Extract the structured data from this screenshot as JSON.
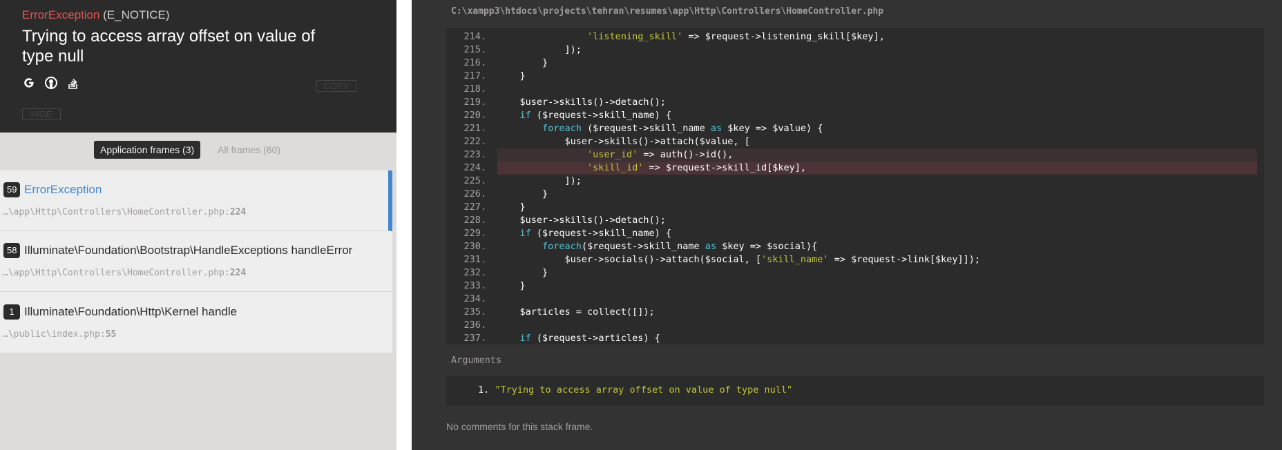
{
  "error": {
    "class": "ErrorException",
    "level": "(E_NOTICE)",
    "message": "Trying to access array offset on value of type null",
    "copy_label": "COPY",
    "hide_label": "HIDE",
    "search_icons": [
      "google-icon",
      "duckduckgo-icon",
      "stackoverflow-icon"
    ]
  },
  "filters": {
    "application": "Application frames (3)",
    "all": "All frames (60)"
  },
  "frames": [
    {
      "num": "59",
      "title": "ErrorException",
      "file": "…\\app\\Http\\Controllers\\HomeController.php",
      "line": "224"
    },
    {
      "num": "58",
      "title": "Illuminate\\Foundation\\Bootstrap\\HandleExceptions handleError",
      "file": "…\\app\\Http\\Controllers\\HomeController.php",
      "line": "224"
    },
    {
      "num": "1",
      "title": "Illuminate\\Foundation\\Http\\Kernel handle",
      "file": "…\\public\\index.php",
      "line": "55"
    }
  ],
  "code": {
    "path": "C:\\xampp3\\htdocs\\projects\\tehran\\resumes\\app\\Http\\Controllers\\HomeController.php",
    "lines": [
      {
        "n": "214.",
        "text": "                'listening_skill' => $request->listening_skill[$key],"
      },
      {
        "n": "215.",
        "text": "            ]);"
      },
      {
        "n": "216.",
        "text": "        }"
      },
      {
        "n": "217.",
        "text": "    }"
      },
      {
        "n": "218.",
        "text": ""
      },
      {
        "n": "219.",
        "text": "    $user->skills()->detach();"
      },
      {
        "n": "220.",
        "text": "    if ($request->skill_name) {"
      },
      {
        "n": "221.",
        "text": "        foreach ($request->skill_name as $key => $value) {"
      },
      {
        "n": "222.",
        "text": "            $user->skills()->attach($value, ["
      },
      {
        "n": "223.",
        "text": "                'user_id' => auth()->id(),"
      },
      {
        "n": "224.",
        "text": "                'skill_id' => $request->skill_id[$key],"
      },
      {
        "n": "225.",
        "text": "            ]);"
      },
      {
        "n": "226.",
        "text": "        }"
      },
      {
        "n": "227.",
        "text": "    }"
      },
      {
        "n": "228.",
        "text": "    $user->skills()->detach();"
      },
      {
        "n": "229.",
        "text": "    if ($request->skill_name) {"
      },
      {
        "n": "230.",
        "text": "        foreach($request->skill_name as $key => $social){"
      },
      {
        "n": "231.",
        "text": "            $user->socials()->attach($social, ['skill_name' => $request->link[$key]]);"
      },
      {
        "n": "232.",
        "text": "        }"
      },
      {
        "n": "233.",
        "text": "    }"
      },
      {
        "n": "234.",
        "text": ""
      },
      {
        "n": "235.",
        "text": "    $articles = collect([]);"
      },
      {
        "n": "236.",
        "text": ""
      },
      {
        "n": "237.",
        "text": "    if ($request->articles) {"
      }
    ],
    "highlight_lines": [
      "223.",
      "224."
    ],
    "error_line": "224."
  },
  "arguments": {
    "title": "Arguments",
    "items": [
      {
        "index": "1.",
        "value": "\"Trying to access array offset on value of type null\""
      }
    ]
  },
  "comments_text": "No comments for this stack frame."
}
